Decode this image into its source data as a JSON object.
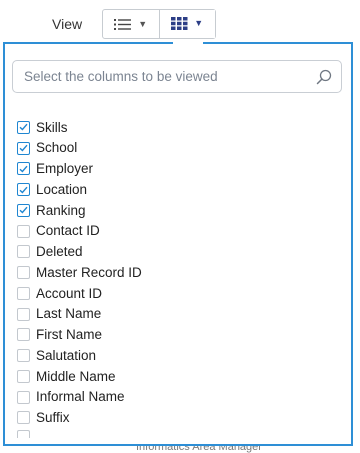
{
  "toolbar": {
    "view_label": "View",
    "list_icon": "list-icon",
    "grid_icon": "grid-icon",
    "accent": "#2e8fd6",
    "grid_color": "#2c3e86"
  },
  "search": {
    "placeholder": "Select the columns to be viewed",
    "value": ""
  },
  "columns": [
    {
      "label": "Skills",
      "checked": true
    },
    {
      "label": "School",
      "checked": true
    },
    {
      "label": "Employer",
      "checked": true
    },
    {
      "label": "Location",
      "checked": true
    },
    {
      "label": "Ranking",
      "checked": true
    },
    {
      "label": "Contact ID",
      "checked": false
    },
    {
      "label": "Deleted",
      "checked": false
    },
    {
      "label": "Master Record ID",
      "checked": false
    },
    {
      "label": "Account ID",
      "checked": false
    },
    {
      "label": "Last Name",
      "checked": false
    },
    {
      "label": "First Name",
      "checked": false
    },
    {
      "label": "Salutation",
      "checked": false
    },
    {
      "label": "Middle Name",
      "checked": false
    },
    {
      "label": "Informal Name",
      "checked": false
    },
    {
      "label": "Suffix",
      "checked": false
    }
  ],
  "background_text": "Informatics Area Manager"
}
